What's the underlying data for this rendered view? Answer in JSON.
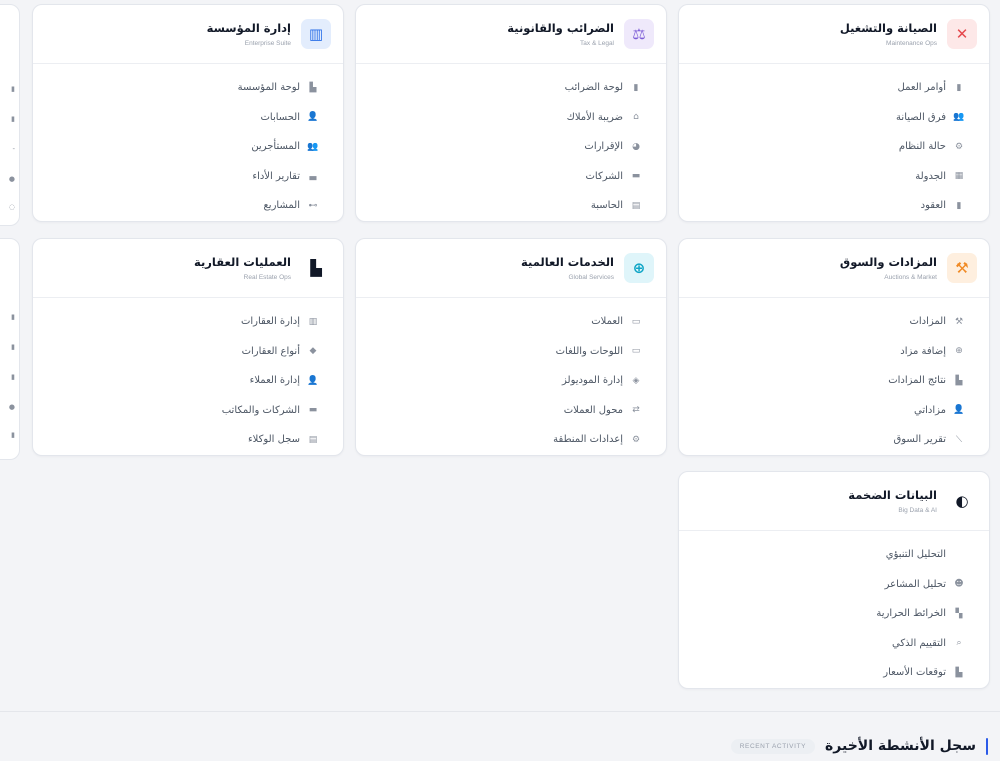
{
  "colors": {
    "accent": "#2b5ae8",
    "maintenance": "#e5484d",
    "tax": "#7c5cd6",
    "enterprise": "#2b6fe8",
    "auctions": "#f08a24",
    "global": "#0ea5c6",
    "bigdata": "#111827"
  },
  "cards": {
    "maintenance": {
      "title": "الصيانة والتشغيل",
      "subtitle": "Maintenance Ops",
      "icon": "wrench-screwdriver-icon",
      "items": [
        {
          "label": "أوامر العمل",
          "icon": "clipboard-icon"
        },
        {
          "label": "فرق الصيانة",
          "icon": "users-icon"
        },
        {
          "label": "حالة النظام",
          "icon": "gears-icon"
        },
        {
          "label": "الجدولة",
          "icon": "calendar-icon"
        },
        {
          "label": "العقود",
          "icon": "file-icon"
        }
      ]
    },
    "tax": {
      "title": "الضرائب والقانونية",
      "subtitle": "Tax & Legal",
      "icon": "scales-icon",
      "items": [
        {
          "label": "لوحة الضرائب",
          "icon": "file-icon"
        },
        {
          "label": "ضريبة الأملاك",
          "icon": "home-icon"
        },
        {
          "label": "الإقرارات",
          "icon": "pie-chart-icon"
        },
        {
          "label": "الشركات",
          "icon": "briefcase-icon"
        },
        {
          "label": "الحاسبة",
          "icon": "calculator-icon"
        }
      ]
    },
    "enterprise": {
      "title": "إدارة المؤسسة",
      "subtitle": "Enterprise Suite",
      "icon": "building-icon",
      "items": [
        {
          "label": "لوحة المؤسسة",
          "icon": "industry-icon"
        },
        {
          "label": "الحسابات",
          "icon": "user-cog-icon"
        },
        {
          "label": "المستأجرين",
          "icon": "users-icon"
        },
        {
          "label": "تقارير الأداء",
          "icon": "chart-icon"
        },
        {
          "label": "المشاريع",
          "icon": "project-diagram-icon"
        }
      ]
    },
    "auctions": {
      "title": "المزادات والسوق",
      "subtitle": "Auctions & Market",
      "icon": "gavel-icon",
      "items": [
        {
          "label": "المزادات",
          "icon": "gavel-icon"
        },
        {
          "label": "إضافة مزاد",
          "icon": "plus-circle-icon"
        },
        {
          "label": "نتائج المزادات",
          "icon": "chart-bar-icon"
        },
        {
          "label": "مزاداتي",
          "icon": "user-cog-icon"
        },
        {
          "label": "تقرير السوق",
          "icon": "chart-line-icon"
        }
      ]
    },
    "global": {
      "title": "الخدمات العالمية",
      "subtitle": "Global Services",
      "icon": "globe-icon",
      "items": [
        {
          "label": "العملات",
          "icon": "money-bill-icon"
        },
        {
          "label": "اللوحات واللغات",
          "icon": "language-icon"
        },
        {
          "label": "إدارة الموديولز",
          "icon": "cubes-icon"
        },
        {
          "label": "محول العملات",
          "icon": "exchange-icon"
        },
        {
          "label": "إعدادات المنطقة",
          "icon": "cog-icon"
        }
      ]
    },
    "realestate": {
      "title": "العمليات العقارية",
      "subtitle": "Real Estate Ops",
      "icon": "city-icon",
      "items": [
        {
          "label": "إدارة العقارات",
          "icon": "building-icon"
        },
        {
          "label": "أنواع العقارات",
          "icon": "tags-icon"
        },
        {
          "label": "إدارة العملاء",
          "icon": "user-tie-icon"
        },
        {
          "label": "الشركات والمكاتب",
          "icon": "briefcase-icon"
        },
        {
          "label": "سجل الوكلاء",
          "icon": "id-card-icon"
        }
      ]
    },
    "bigdata": {
      "title": "البيانات الضخمة",
      "subtitle": "Big Data & AI",
      "icon": "brain-icon",
      "items": [
        {
          "label": "التحليل التنبؤي",
          "icon": ""
        },
        {
          "label": "تحليل المشاعر",
          "icon": "smile-icon"
        },
        {
          "label": "الخرائط الحرارية",
          "icon": "map-icon"
        },
        {
          "label": "التقييم الذكي",
          "icon": "search-icon"
        },
        {
          "label": "توقعات الأسعار",
          "icon": "chart-bar-icon"
        }
      ]
    }
  },
  "recent_activity": {
    "title": "سجل الأنشطة الأخيرة",
    "badge": "RECENT ACTIVITY"
  }
}
